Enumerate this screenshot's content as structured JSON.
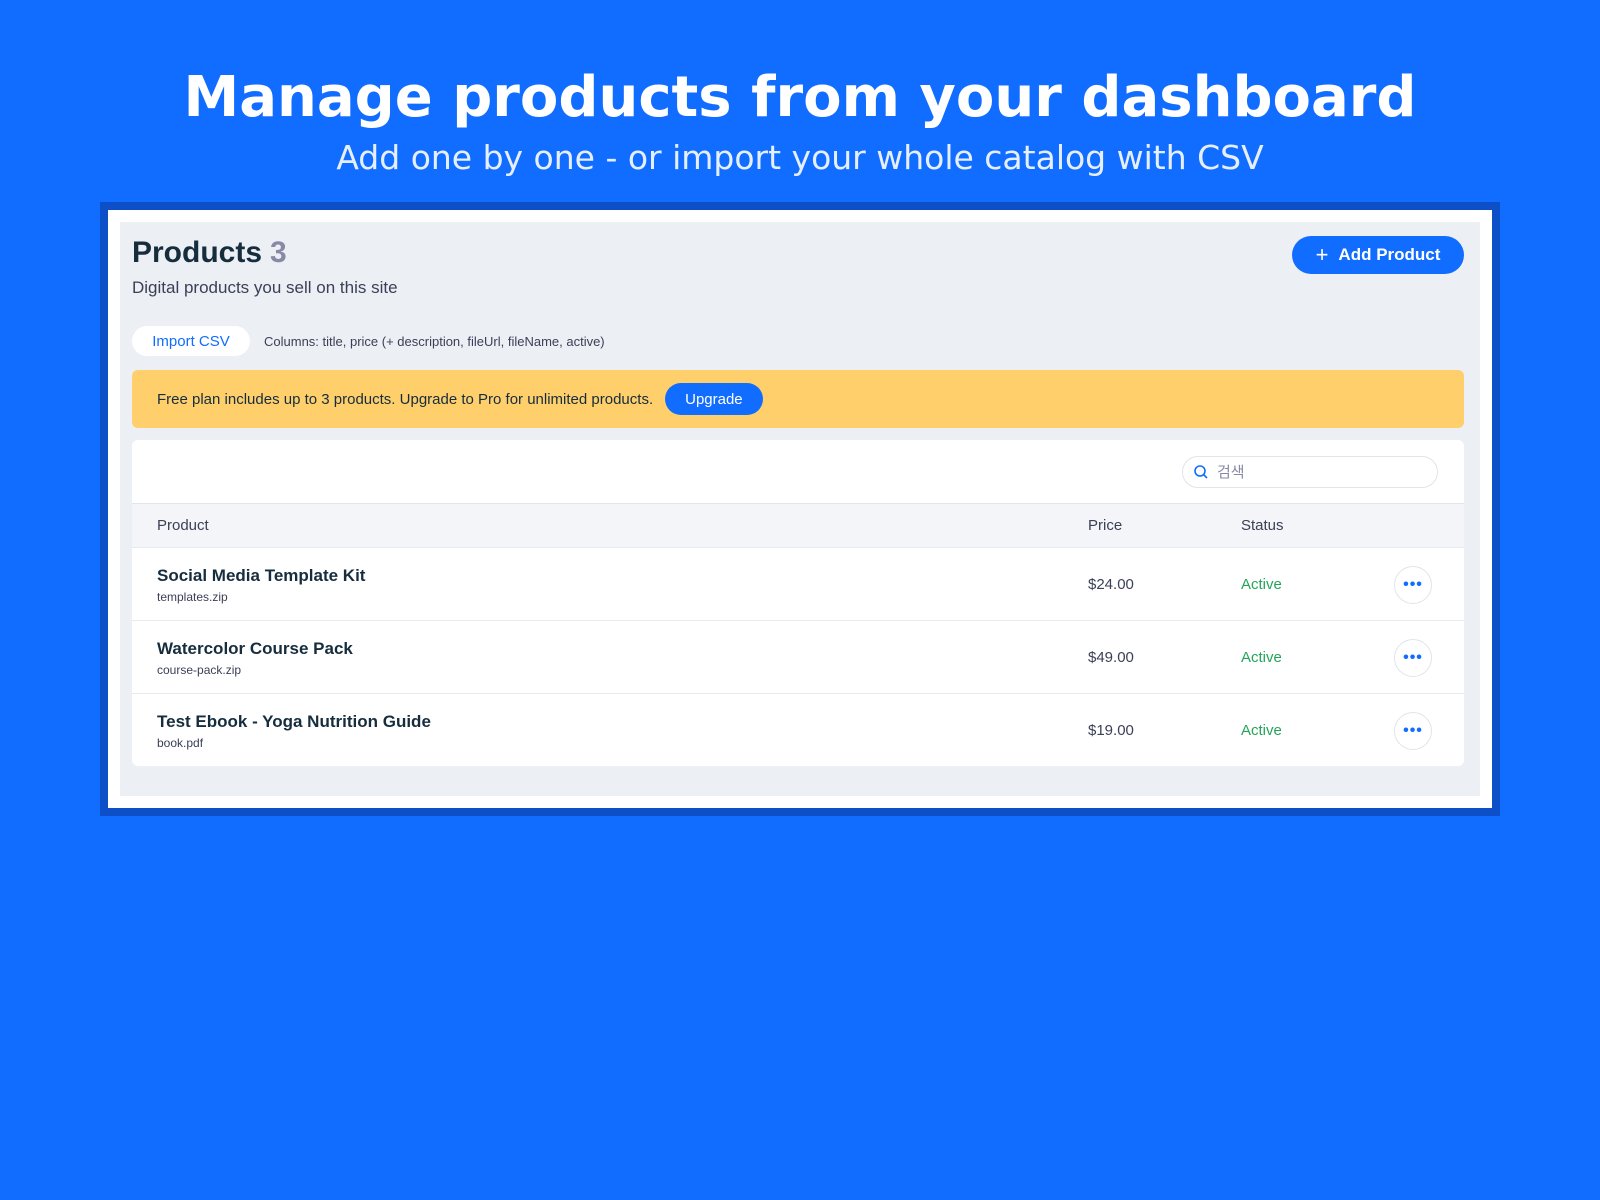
{
  "hero": {
    "title": "Manage products from your dashboard",
    "subtitle": "Add one by one - or import your whole catalog with CSV"
  },
  "header": {
    "title": "Products",
    "count": "3",
    "subtitle": "Digital products you sell on this site",
    "add_button_label": "Add Product"
  },
  "import": {
    "button_label": "Import CSV",
    "hint": "Columns: title, price (+ description, fileUrl, fileName, active)"
  },
  "banner": {
    "text": "Free plan includes up to 3 products. Upgrade to Pro for unlimited products.",
    "button_label": "Upgrade"
  },
  "search": {
    "placeholder": "검색",
    "value": ""
  },
  "table": {
    "columns": [
      "Product",
      "Price",
      "Status"
    ],
    "rows": [
      {
        "name": "Social Media Template Kit",
        "file": "templates.zip",
        "price": "$24.00",
        "status": "Active"
      },
      {
        "name": "Watercolor Course Pack",
        "file": "course-pack.zip",
        "price": "$49.00",
        "status": "Active"
      },
      {
        "name": "Test Ebook - Yoga Nutrition Guide",
        "file": "book.pdf",
        "price": "$19.00",
        "status": "Active"
      }
    ],
    "more_icon": "more-horizontal-icon"
  },
  "colors": {
    "background": "#116dff",
    "accent": "#116dff",
    "banner": "#fecf6b",
    "status_active": "#25a55a"
  }
}
